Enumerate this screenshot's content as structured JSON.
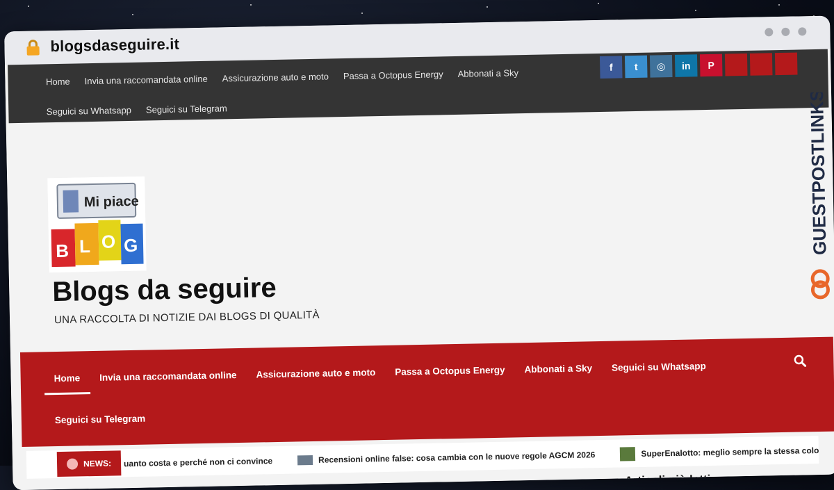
{
  "browser": {
    "url": "blogsdaseguire.it"
  },
  "topbar": {
    "nav": [
      "Home",
      "Invia una raccomandata online",
      "Assicurazione auto e moto",
      "Passa a Octopus Energy",
      "Abbonati a Sky",
      "Seguici su Whatsapp",
      "Seguici su Telegram"
    ],
    "social": [
      {
        "name": "facebook-icon",
        "glyph": "f",
        "color": "#3b5998"
      },
      {
        "name": "twitter-icon",
        "glyph": "t",
        "color": "#3a8fcf"
      },
      {
        "name": "instagram-icon",
        "glyph": "◎",
        "color": "#3f729b"
      },
      {
        "name": "linkedin-icon",
        "glyph": "in",
        "color": "#0e76a8"
      },
      {
        "name": "pinterest-icon",
        "glyph": "P",
        "color": "#c8102e"
      },
      {
        "name": "social-icon-6",
        "glyph": "",
        "color": "#b4191b"
      },
      {
        "name": "social-icon-7",
        "glyph": "",
        "color": "#b4191b"
      },
      {
        "name": "social-icon-8",
        "glyph": "",
        "color": "#b4191b"
      }
    ]
  },
  "header": {
    "logo_text_1": "Mi piace",
    "logo_text_2": "BLOG",
    "title": "Blogs da seguire",
    "tagline": "UNA RACCOLTA DI NOTIZIE DAI BLOGS DI QUALITÀ"
  },
  "mainnav": {
    "row1": [
      "Home",
      "Invia una raccomandata online",
      "Assicurazione auto e moto",
      "Passa a Octopus Energy",
      "Abbonati a Sky",
      "Seguici su Whatsapp"
    ],
    "row2": [
      "Seguici su Telegram"
    ],
    "active": "Home"
  },
  "ticker": {
    "label": "NEWS:",
    "items": [
      "uanto costa e perché non ci convince",
      "Recensioni online false: cosa cambia con le nuove regole AGCM 2026",
      "SuperEnalotto: meglio sempre la stessa colo"
    ]
  },
  "sidebar": {
    "heading": "Articoli più letti"
  },
  "watermark": "GUESTPOSTLINKS",
  "colors": {
    "accent": "#b4191b",
    "topbar": "#343434"
  }
}
